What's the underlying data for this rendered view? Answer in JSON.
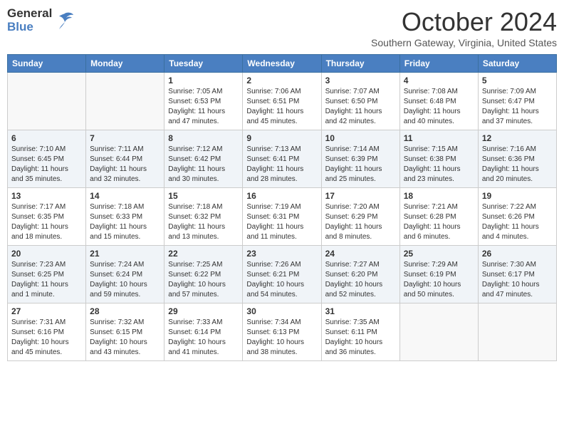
{
  "header": {
    "logo_line1": "General",
    "logo_line2": "Blue",
    "month_title": "October 2024",
    "subtitle": "Southern Gateway, Virginia, United States"
  },
  "days_of_week": [
    "Sunday",
    "Monday",
    "Tuesday",
    "Wednesday",
    "Thursday",
    "Friday",
    "Saturday"
  ],
  "weeks": [
    [
      {
        "num": "",
        "info": ""
      },
      {
        "num": "",
        "info": ""
      },
      {
        "num": "1",
        "info": "Sunrise: 7:05 AM\nSunset: 6:53 PM\nDaylight: 11 hours and 47 minutes."
      },
      {
        "num": "2",
        "info": "Sunrise: 7:06 AM\nSunset: 6:51 PM\nDaylight: 11 hours and 45 minutes."
      },
      {
        "num": "3",
        "info": "Sunrise: 7:07 AM\nSunset: 6:50 PM\nDaylight: 11 hours and 42 minutes."
      },
      {
        "num": "4",
        "info": "Sunrise: 7:08 AM\nSunset: 6:48 PM\nDaylight: 11 hours and 40 minutes."
      },
      {
        "num": "5",
        "info": "Sunrise: 7:09 AM\nSunset: 6:47 PM\nDaylight: 11 hours and 37 minutes."
      }
    ],
    [
      {
        "num": "6",
        "info": "Sunrise: 7:10 AM\nSunset: 6:45 PM\nDaylight: 11 hours and 35 minutes."
      },
      {
        "num": "7",
        "info": "Sunrise: 7:11 AM\nSunset: 6:44 PM\nDaylight: 11 hours and 32 minutes."
      },
      {
        "num": "8",
        "info": "Sunrise: 7:12 AM\nSunset: 6:42 PM\nDaylight: 11 hours and 30 minutes."
      },
      {
        "num": "9",
        "info": "Sunrise: 7:13 AM\nSunset: 6:41 PM\nDaylight: 11 hours and 28 minutes."
      },
      {
        "num": "10",
        "info": "Sunrise: 7:14 AM\nSunset: 6:39 PM\nDaylight: 11 hours and 25 minutes."
      },
      {
        "num": "11",
        "info": "Sunrise: 7:15 AM\nSunset: 6:38 PM\nDaylight: 11 hours and 23 minutes."
      },
      {
        "num": "12",
        "info": "Sunrise: 7:16 AM\nSunset: 6:36 PM\nDaylight: 11 hours and 20 minutes."
      }
    ],
    [
      {
        "num": "13",
        "info": "Sunrise: 7:17 AM\nSunset: 6:35 PM\nDaylight: 11 hours and 18 minutes."
      },
      {
        "num": "14",
        "info": "Sunrise: 7:18 AM\nSunset: 6:33 PM\nDaylight: 11 hours and 15 minutes."
      },
      {
        "num": "15",
        "info": "Sunrise: 7:18 AM\nSunset: 6:32 PM\nDaylight: 11 hours and 13 minutes."
      },
      {
        "num": "16",
        "info": "Sunrise: 7:19 AM\nSunset: 6:31 PM\nDaylight: 11 hours and 11 minutes."
      },
      {
        "num": "17",
        "info": "Sunrise: 7:20 AM\nSunset: 6:29 PM\nDaylight: 11 hours and 8 minutes."
      },
      {
        "num": "18",
        "info": "Sunrise: 7:21 AM\nSunset: 6:28 PM\nDaylight: 11 hours and 6 minutes."
      },
      {
        "num": "19",
        "info": "Sunrise: 7:22 AM\nSunset: 6:26 PM\nDaylight: 11 hours and 4 minutes."
      }
    ],
    [
      {
        "num": "20",
        "info": "Sunrise: 7:23 AM\nSunset: 6:25 PM\nDaylight: 11 hours and 1 minute."
      },
      {
        "num": "21",
        "info": "Sunrise: 7:24 AM\nSunset: 6:24 PM\nDaylight: 10 hours and 59 minutes."
      },
      {
        "num": "22",
        "info": "Sunrise: 7:25 AM\nSunset: 6:22 PM\nDaylight: 10 hours and 57 minutes."
      },
      {
        "num": "23",
        "info": "Sunrise: 7:26 AM\nSunset: 6:21 PM\nDaylight: 10 hours and 54 minutes."
      },
      {
        "num": "24",
        "info": "Sunrise: 7:27 AM\nSunset: 6:20 PM\nDaylight: 10 hours and 52 minutes."
      },
      {
        "num": "25",
        "info": "Sunrise: 7:29 AM\nSunset: 6:19 PM\nDaylight: 10 hours and 50 minutes."
      },
      {
        "num": "26",
        "info": "Sunrise: 7:30 AM\nSunset: 6:17 PM\nDaylight: 10 hours and 47 minutes."
      }
    ],
    [
      {
        "num": "27",
        "info": "Sunrise: 7:31 AM\nSunset: 6:16 PM\nDaylight: 10 hours and 45 minutes."
      },
      {
        "num": "28",
        "info": "Sunrise: 7:32 AM\nSunset: 6:15 PM\nDaylight: 10 hours and 43 minutes."
      },
      {
        "num": "29",
        "info": "Sunrise: 7:33 AM\nSunset: 6:14 PM\nDaylight: 10 hours and 41 minutes."
      },
      {
        "num": "30",
        "info": "Sunrise: 7:34 AM\nSunset: 6:13 PM\nDaylight: 10 hours and 38 minutes."
      },
      {
        "num": "31",
        "info": "Sunrise: 7:35 AM\nSunset: 6:11 PM\nDaylight: 10 hours and 36 minutes."
      },
      {
        "num": "",
        "info": ""
      },
      {
        "num": "",
        "info": ""
      }
    ]
  ]
}
